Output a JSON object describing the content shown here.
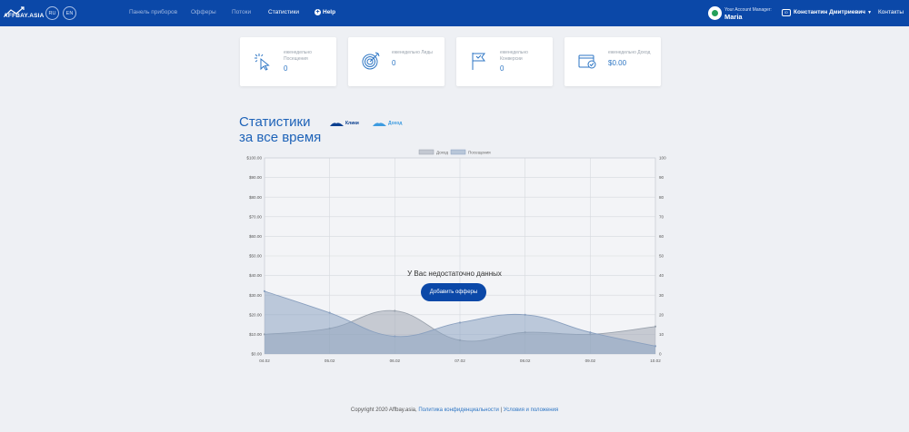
{
  "header": {
    "logo_text": "AFFBAY.ASIA",
    "languages": [
      "RU",
      "EN"
    ],
    "nav": [
      "Панель приборов",
      "Офферы",
      "Потоки",
      "Статистики",
      "Help"
    ],
    "active_nav": "Статистики",
    "account_manager_label": "Your Account Manager:",
    "account_manager_name": "Maria",
    "user_badge": "ID",
    "user_name": "Константин Дмитриевич",
    "contacts": "Контакты"
  },
  "cards": [
    {
      "label": "еженедельно Посещения",
      "value": "0",
      "icon": "cursor-click-icon"
    },
    {
      "label": "еженедельно Лиды",
      "value": "0",
      "icon": "target-icon"
    },
    {
      "label": "еженедельно Конверсии",
      "value": "0",
      "icon": "flag-icon"
    },
    {
      "label": "еженедельно Доход",
      "value": "$0.00",
      "icon": "wallet-icon"
    }
  ],
  "stats": {
    "title_line1": "Статистики",
    "title_line2": "за все время",
    "legend_clicks": "Клики",
    "legend_income": "Доход",
    "no_data": "У Вас недостаточно данных",
    "add_offers": "Добавить офферы"
  },
  "chart_data": {
    "type": "area",
    "categories": [
      "04.02",
      "05.02",
      "06.02",
      "07.02",
      "08.02",
      "09.02",
      "10.02"
    ],
    "legend": [
      "Доход",
      "Посещения"
    ],
    "legend_position": "top",
    "grid": true,
    "y_left": {
      "min": 0,
      "max": 100,
      "ticks": [
        "$0.00",
        "$10.00",
        "$20.00",
        "$30.00",
        "$40.00",
        "$50.00",
        "$60.00",
        "$70.00",
        "$80.00",
        "$90.00",
        "$100.00"
      ]
    },
    "y_right": {
      "min": 0,
      "max": 100,
      "ticks": [
        "0",
        "10",
        "20",
        "30",
        "40",
        "50",
        "60",
        "70",
        "80",
        "90",
        "100"
      ]
    },
    "series": [
      {
        "name": "Доход",
        "axis": "left",
        "values": [
          10,
          13,
          22,
          7,
          11,
          10,
          14
        ],
        "color": "#a0a8b4"
      },
      {
        "name": "Посещения",
        "axis": "right",
        "values": [
          32,
          21,
          9,
          16,
          20,
          11,
          4
        ],
        "color": "#8da4c3"
      }
    ]
  },
  "footer": {
    "copyright": "Copyright 2020 Affbay.asia, ",
    "privacy": "Политика конфиденциальности",
    "sep": " | ",
    "terms": "Условия и положения"
  }
}
